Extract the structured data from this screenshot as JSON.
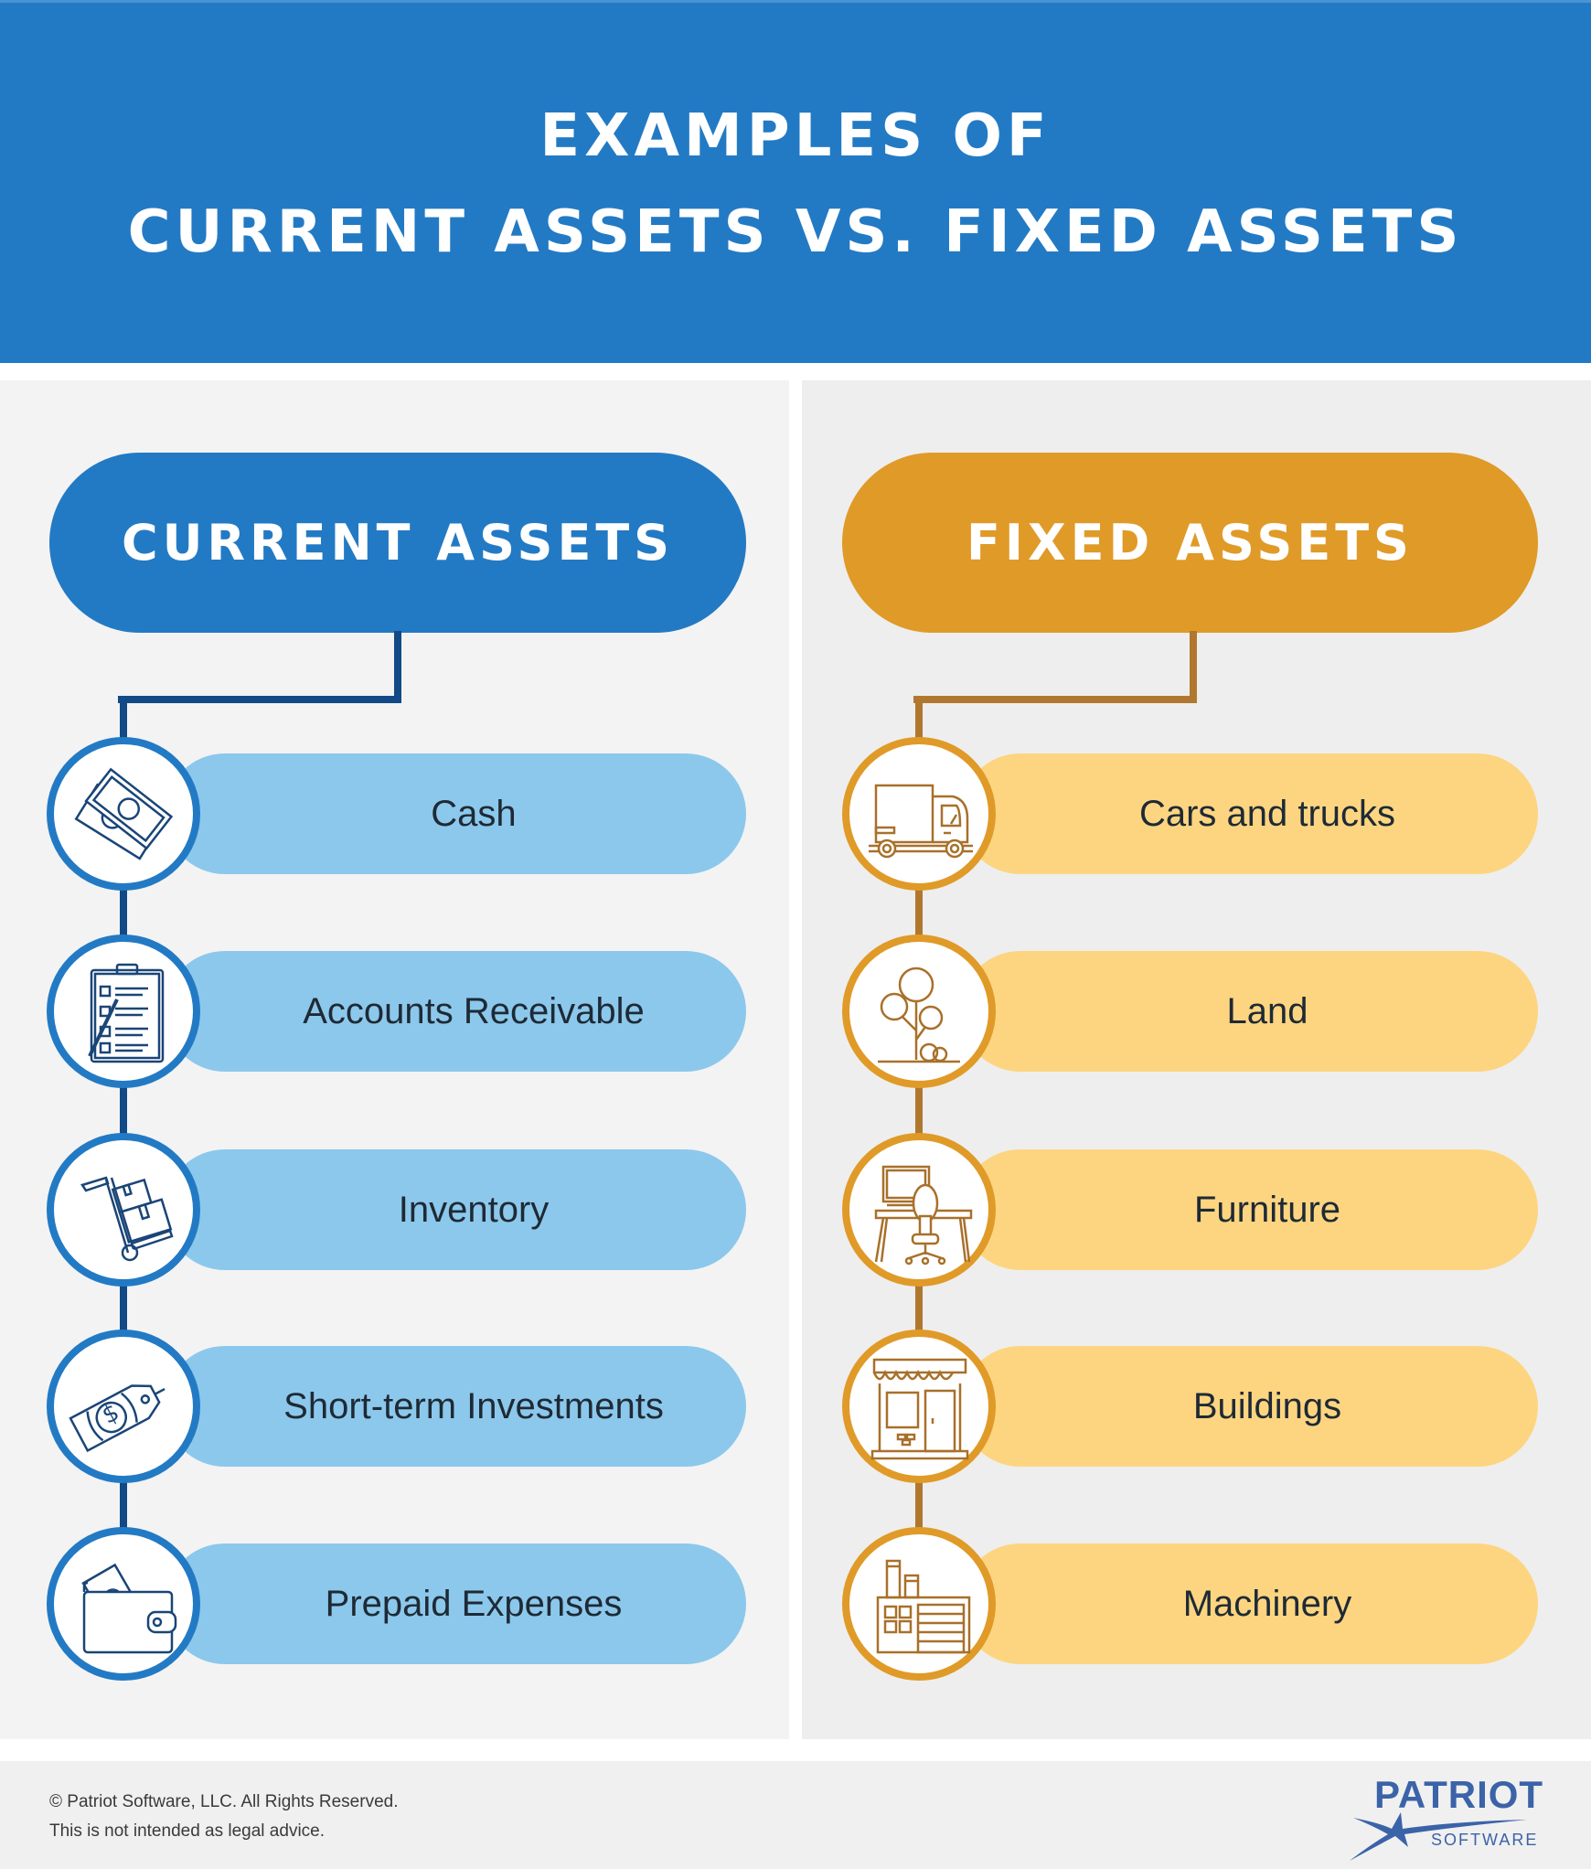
{
  "header": {
    "title_line1": "EXAMPLES OF",
    "title_line2": "CURRENT ASSETS VS. FIXED ASSETS",
    "background": "#237ac4"
  },
  "columns": [
    {
      "category": "CURRENT ASSETS",
      "colors": {
        "pill": "#237ac4",
        "ring": "#237ac4",
        "connector": "#114a86",
        "item_bg": "#8cc8ec",
        "icon_stroke": "#1a4577"
      },
      "items": [
        {
          "label": "Cash",
          "icon": "cash-icon"
        },
        {
          "label": "Accounts Receivable",
          "icon": "clipboard-checklist-icon"
        },
        {
          "label": "Inventory",
          "icon": "hand-truck-boxes-icon"
        },
        {
          "label": "Short-term Investments",
          "icon": "money-tag-icon"
        },
        {
          "label": "Prepaid Expenses",
          "icon": "wallet-icon"
        }
      ]
    },
    {
      "category": "FIXED ASSETS",
      "colors": {
        "pill": "#e09a28",
        "ring": "#e09a28",
        "connector": "#b0782e",
        "item_bg": "#fdd580",
        "icon_stroke": "#a8702a"
      },
      "items": [
        {
          "label": "Cars and trucks",
          "icon": "truck-icon"
        },
        {
          "label": "Land",
          "icon": "tree-icon"
        },
        {
          "label": "Furniture",
          "icon": "desk-chair-icon"
        },
        {
          "label": "Buildings",
          "icon": "storefront-icon"
        },
        {
          "label": "Machinery",
          "icon": "factory-icon"
        }
      ]
    }
  ],
  "footer": {
    "copyright": "© Patriot Software, LLC. All Rights Reserved.",
    "disclaimer": "This is not intended as legal advice.",
    "logo_word": "PATRIOT",
    "logo_sub": "SOFTWARE",
    "logo_color": "#3b63a8"
  }
}
